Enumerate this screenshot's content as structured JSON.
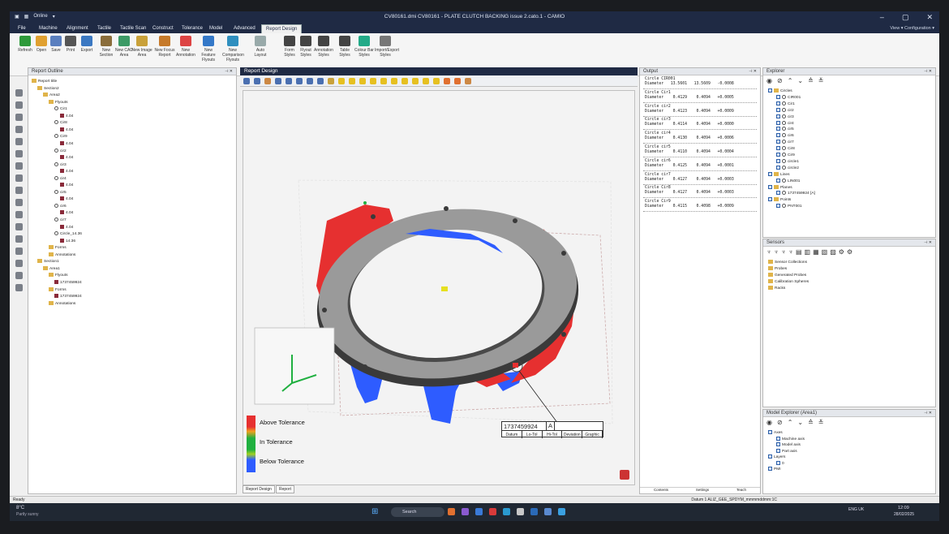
{
  "titlebar": {
    "title": "CV80161.dmi  CV80161 - PLATE CLUTCH BACKING issue 2.cato.1 - CAMIO",
    "mode": "Online"
  },
  "tabs": [
    "File",
    "Machine",
    "Alignment",
    "Tactile",
    "Tactile Scan",
    "Construct",
    "Tolerance",
    "Model",
    "Advanced",
    "Report Design"
  ],
  "tabs_right": "View ▾  Configuration ▾",
  "ribbon": {
    "buttons": [
      {
        "label": "Refresh",
        "color": "#2e9a3a"
      },
      {
        "label": "Open",
        "color": "#e0a030"
      },
      {
        "label": "Save",
        "color": "#5a7fbf"
      },
      {
        "label": "Print",
        "color": "#555"
      },
      {
        "label": "Export",
        "color": "#3b78c2"
      },
      {
        "label": "New Section",
        "color": "#8a6d3b"
      },
      {
        "label": "New CAD Area",
        "color": "#3c9a66"
      },
      {
        "label": "New Image Area",
        "color": "#c9a13a"
      },
      {
        "label": "New Focus Report",
        "color": "#c67a2a"
      },
      {
        "label": "New Annotation",
        "color": "#d44"
      },
      {
        "label": "New Feature Flyouts",
        "color": "#3478c8"
      },
      {
        "label": "New Comparison Flyouts",
        "color": "#2f8fbf"
      },
      {
        "label": "Auto Layout",
        "color": "#9aa"
      },
      {
        "label": "Form Styles",
        "color": "#444"
      },
      {
        "label": "Flyout Styles",
        "color": "#444"
      },
      {
        "label": "Annotation Styles",
        "color": "#444"
      },
      {
        "label": "Table Styles",
        "color": "#444"
      },
      {
        "label": "Colour Bar Styles",
        "color": "#2a8"
      },
      {
        "label": "Import/Export Styles",
        "color": "#777"
      }
    ],
    "groups": [
      "Options",
      "Tools",
      "Styles"
    ]
  },
  "report_outline": {
    "title": "Report Outline",
    "rows": [
      {
        "t": "Report title",
        "k": "root",
        "d": 0
      },
      {
        "t": "Section2",
        "k": "sec",
        "d": 1
      },
      {
        "t": "Area2",
        "k": "sec",
        "d": 2
      },
      {
        "t": "Flyouts",
        "k": "fold",
        "d": 3
      },
      {
        "t": "Cir1",
        "k": "node",
        "d": 4
      },
      {
        "t": "4.04",
        "k": "x",
        "d": 5
      },
      {
        "t": "Cir8",
        "k": "node",
        "d": 4
      },
      {
        "t": "4.04",
        "k": "x",
        "d": 5
      },
      {
        "t": "Cir9",
        "k": "node",
        "d": 4
      },
      {
        "t": "4.04",
        "k": "x",
        "d": 5
      },
      {
        "t": "cir2",
        "k": "node",
        "d": 4
      },
      {
        "t": "4.04",
        "k": "x",
        "d": 5
      },
      {
        "t": "cir3",
        "k": "node",
        "d": 4
      },
      {
        "t": "4.04",
        "k": "x",
        "d": 5
      },
      {
        "t": "cir4",
        "k": "node",
        "d": 4
      },
      {
        "t": "4.04",
        "k": "x",
        "d": 5
      },
      {
        "t": "cir5",
        "k": "node",
        "d": 4
      },
      {
        "t": "4.04",
        "k": "x",
        "d": 5
      },
      {
        "t": "cir6",
        "k": "node",
        "d": 4
      },
      {
        "t": "4.04",
        "k": "x",
        "d": 5
      },
      {
        "t": "cir7",
        "k": "node",
        "d": 4
      },
      {
        "t": "4.04",
        "k": "x",
        "d": 5
      },
      {
        "t": "Circle_14.36",
        "k": "node",
        "d": 4
      },
      {
        "t": "14.36",
        "k": "x",
        "d": 5
      },
      {
        "t": "Forms",
        "k": "fold",
        "d": 3
      },
      {
        "t": "Annotations",
        "k": "fold",
        "d": 3
      },
      {
        "t": "Section1",
        "k": "sec",
        "d": 1
      },
      {
        "t": "Area1",
        "k": "sec",
        "d": 2
      },
      {
        "t": "Flyouts",
        "k": "fold",
        "d": 3
      },
      {
        "t": "1737459924",
        "k": "x",
        "d": 4
      },
      {
        "t": "Forms",
        "k": "fold",
        "d": 3
      },
      {
        "t": "1737459924",
        "k": "x",
        "d": 4
      },
      {
        "t": "Annotations",
        "k": "fold",
        "d": 3
      }
    ]
  },
  "report_design": {
    "title": "Report Design",
    "legend": [
      "Above Tolerance",
      "In Tolerance",
      "Below Tolerance"
    ],
    "callout": {
      "id": "1737459924",
      "datum": "A",
      "cols": [
        "Datum",
        "Lo-Tol",
        "Hi-Tol",
        "Deviation",
        "Graphic"
      ]
    },
    "bottom_tabs": [
      "Report Design",
      "Report"
    ]
  },
  "output": {
    "title": "Output",
    "rows": [
      {
        "name": "Circle CIR001",
        "vals": "13.5601   13.5609   -0.0008"
      },
      {
        "name": "Circle Cir1",
        "vals": " 0.4129    0.4094   +0.0005"
      },
      {
        "name": "Circle cir2",
        "vals": " 0.4123    0.4094   +0.0009"
      },
      {
        "name": "Circle cir3",
        "vals": " 0.4114    0.4094   +0.0000"
      },
      {
        "name": "Circle cir4",
        "vals": " 0.4130    0.4094   +0.0006"
      },
      {
        "name": "Circle cir5",
        "vals": " 0.4110    0.4094   +0.0004"
      },
      {
        "name": "Circle cir6",
        "vals": " 0.4125    0.4094   +0.0001"
      },
      {
        "name": "Circle cir7",
        "vals": " 0.4127    0.4094   +0.0003"
      },
      {
        "name": "Circle Cir8",
        "vals": " 0.4127    0.4094   +0.0003"
      },
      {
        "name": "Circle Cir9",
        "vals": " 0.4115    0.4098   +0.0009"
      }
    ],
    "sub": "Diameter",
    "bottom_tabs": [
      "Contents",
      "Settings",
      "Teach"
    ]
  },
  "explorer": {
    "title": "Explorer",
    "rows": [
      {
        "t": "Circles",
        "k": "fold",
        "d": 0
      },
      {
        "t": "CIR001",
        "k": "chk",
        "d": 1
      },
      {
        "t": "Cir1",
        "k": "chk",
        "d": 1
      },
      {
        "t": "cir2",
        "k": "chk",
        "d": 1
      },
      {
        "t": "cir3",
        "k": "chk",
        "d": 1
      },
      {
        "t": "cir4",
        "k": "chk",
        "d": 1
      },
      {
        "t": "cir5",
        "k": "chk",
        "d": 1
      },
      {
        "t": "cir6",
        "k": "chk",
        "d": 1
      },
      {
        "t": "cir7",
        "k": "chk",
        "d": 1
      },
      {
        "t": "Cir8",
        "k": "chk",
        "d": 1
      },
      {
        "t": "Cir9",
        "k": "chk",
        "d": 1
      },
      {
        "t": "circle1",
        "k": "chk",
        "d": 1
      },
      {
        "t": "circle2",
        "k": "chk",
        "d": 1
      },
      {
        "t": "Lines",
        "k": "fold",
        "d": 0
      },
      {
        "t": "LIN001",
        "k": "chk",
        "d": 1
      },
      {
        "t": "Planes",
        "k": "fold",
        "d": 0
      },
      {
        "t": "1737459924 [A]",
        "k": "chk",
        "d": 1
      },
      {
        "t": "Points",
        "k": "fold",
        "d": 0
      },
      {
        "t": "PNT001",
        "k": "chk",
        "d": 1
      }
    ]
  },
  "sensors": {
    "title": "Sensors",
    "rows": [
      "Sensor Collections",
      "Probes",
      "Generated Probes",
      "Calibration Spheres",
      "Racks"
    ]
  },
  "model_explorer": {
    "title": "Model Explorer (Area1)",
    "rows": [
      {
        "t": "Axes",
        "d": 0
      },
      {
        "t": "Machine axis",
        "d": 1
      },
      {
        "t": "Model axis",
        "d": 1
      },
      {
        "t": "Part axis",
        "d": 1
      },
      {
        "t": "Layers",
        "d": 0
      },
      {
        "t": "0",
        "d": 1
      },
      {
        "t": "PMI",
        "d": 0
      }
    ]
  },
  "status": {
    "left": "Ready",
    "right": "Datum 1     ALIZ_GEE_SPDYM_mmmmddmm:1C"
  },
  "taskbar": {
    "weather_temp": "8°C",
    "weather_desc": "Partly sunny",
    "search": "Search",
    "lang": "ENG UK",
    "time": "12:09",
    "date": "28/02/2025"
  }
}
